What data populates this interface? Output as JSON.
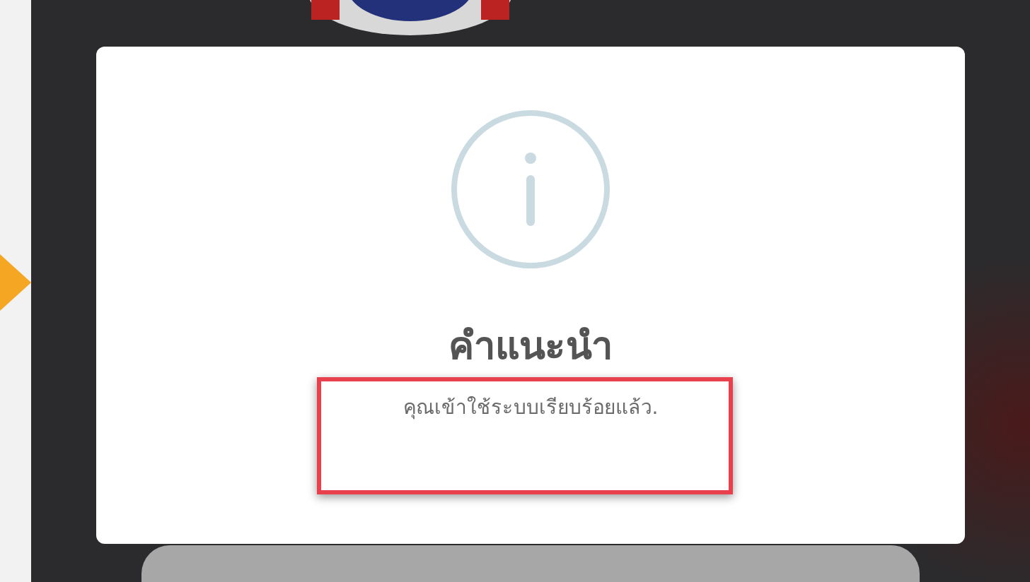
{
  "dialog": {
    "title": "คำแนะนำ",
    "message": "คุณเข้าใช้ระบบเรียบร้อยแล้ว."
  }
}
